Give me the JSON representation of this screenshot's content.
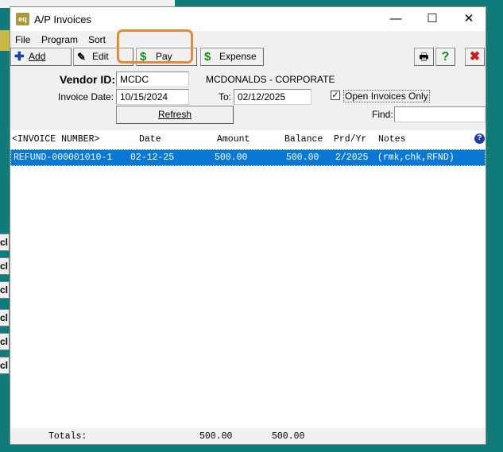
{
  "window": {
    "app_icon_text": "eq",
    "title": "A/P Invoices",
    "controls": {
      "minimize": "—",
      "maximize": "☐",
      "close": "✕"
    }
  },
  "background_stubs": [
    "cl",
    "cl",
    "cl",
    "cl",
    "cl",
    "cl"
  ],
  "menu": [
    "File",
    "Program",
    "Sort"
  ],
  "toolbar": {
    "add": "Add",
    "edit": "Edit",
    "pay": "Pay",
    "expense": "Expense",
    "help": "?",
    "close": "✖"
  },
  "form": {
    "vendor_id_label": "Vendor ID:",
    "vendor_id": "MCDC",
    "vendor_name": "MCDONALDS - CORPORATE",
    "invoice_date_label": "Invoice Date:",
    "invoice_date": "10/15/2024",
    "to_label": "To:",
    "to_date": "02/12/2025",
    "open_only_label": "Open Invoices Only",
    "open_only_checked": "✓",
    "find_label": "Find:",
    "find_value": "",
    "refresh_label": "Refresh"
  },
  "list": {
    "columns": [
      "<INVOICE NUMBER>",
      "Date",
      "Amount",
      "Balance",
      "Prd/Yr",
      "Notes"
    ],
    "help": "?",
    "rows": [
      {
        "invoice": "REFUND-000001010-1",
        "date": "02-12-25",
        "amount": "500.00",
        "balance": "500.00",
        "prd_yr": "2/2025",
        "notes": "(rmk,chk,RFND)"
      }
    ]
  },
  "totals": {
    "label": "Totals:",
    "amount": "500.00",
    "balance": "500.00"
  },
  "colors": {
    "selection": "#0a78d4",
    "highlight": "#e08a3c",
    "background": "#0f7b7b"
  }
}
